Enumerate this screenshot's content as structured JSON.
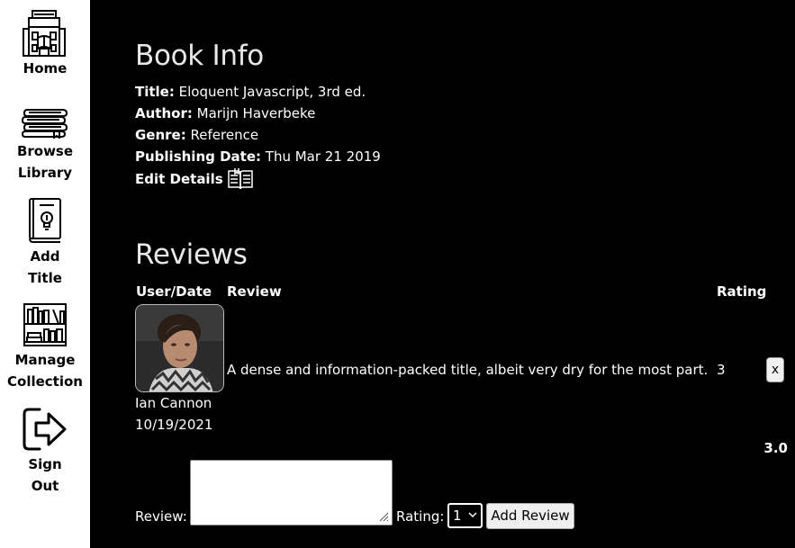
{
  "sidebar": {
    "items": [
      {
        "label": "Home",
        "icon": "library-building-icon"
      },
      {
        "label": "Browse\nLibrary",
        "icon": "book-stack-icon"
      },
      {
        "label": "Add\nTitle",
        "icon": "book-lightbulb-icon"
      },
      {
        "label": "Manage\nCollection",
        "icon": "bookshelf-icon"
      },
      {
        "label": "Sign\nOut",
        "icon": "sign-out-icon"
      }
    ]
  },
  "book_info": {
    "heading": "Book Info",
    "title_label": "Title:",
    "title_value": "Eloquent Javascript, 3rd ed.",
    "author_label": "Author:",
    "author_value": "Marijn Haverbeke",
    "genre_label": "Genre:",
    "genre_value": "Reference",
    "date_label": "Publishing Date:",
    "date_value": "Thu Mar 21 2019",
    "edit_label": "Edit Details",
    "edit_icon": "open-book-icon"
  },
  "reviews": {
    "heading": "Reviews",
    "columns": {
      "user_date": "User/Date",
      "review": "Review",
      "rating": "Rating"
    },
    "rows": [
      {
        "review": "A dense and information-packed title, albeit very dry for the most part.",
        "rating": "3",
        "user": "Ian Cannon",
        "date": "10/19/2021",
        "delete_label": "x"
      }
    ],
    "average": "3.0"
  },
  "form": {
    "review_label": "Review:",
    "review_value": "",
    "rating_label": "Rating:",
    "rating_selected": "1",
    "submit_label": "Add Review"
  }
}
